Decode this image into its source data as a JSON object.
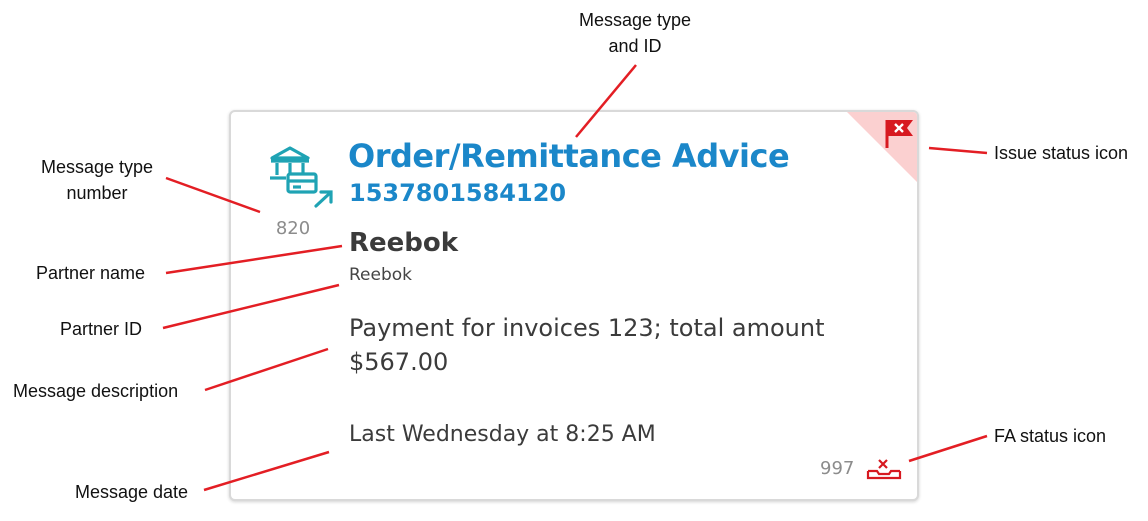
{
  "card": {
    "title": "Order/Remittance Advice",
    "message_id": "1537801584120",
    "type_number": "820",
    "partner_name": "Reebok",
    "partner_id": "Reebok",
    "description": "Payment for invoices 123; total amount $567.00",
    "date": "Last Wednesday at 8:25 AM",
    "fa_code": "997",
    "type_icon": "bank-transfer-icon",
    "issue_icon": "flag-x-icon",
    "fa_icon": "inbox-x-icon"
  },
  "callouts": {
    "message_type_and_id": [
      "Message type",
      "and ID"
    ],
    "message_type_number": [
      "Message type",
      "number"
    ],
    "partner_name": "Partner name",
    "partner_id": "Partner ID",
    "message_description": "Message description",
    "message_date": "Message date",
    "issue_status_icon": "Issue status icon",
    "fa_status_icon": "FA status icon"
  },
  "colors": {
    "title": "#1b87c9",
    "type_icon": "#1fa3b4",
    "issue": "#d71920",
    "corner": "#fbd0d0",
    "fa_icon": "#d71920",
    "leader_line": "#e31e24"
  }
}
